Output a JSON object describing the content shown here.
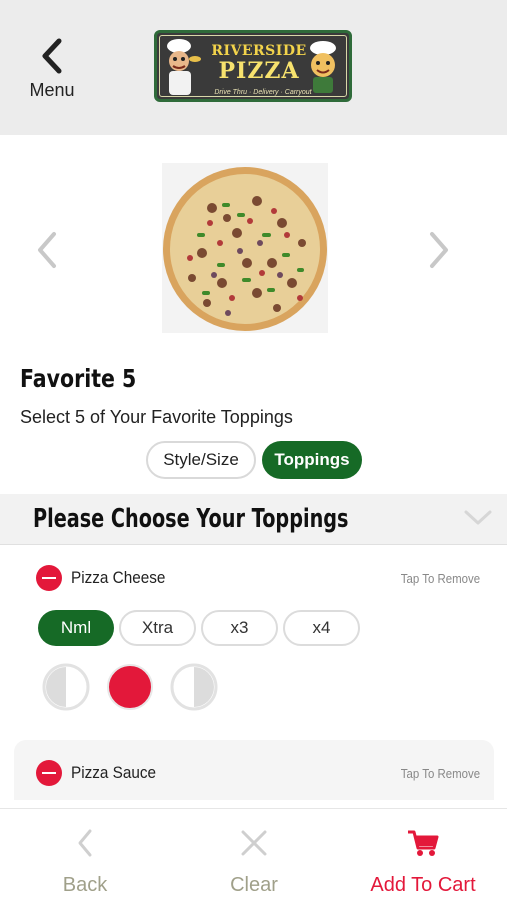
{
  "header": {
    "menu_label": "Menu",
    "logo": {
      "line1": "RIVERSIDE",
      "line2": "PIZZA",
      "tagline": "Drive Thru · Delivery · Carryout"
    }
  },
  "product": {
    "title": "Favorite 5",
    "subtitle": "Select 5 of Your Favorite Toppings",
    "tabs": [
      {
        "label": "Style/Size",
        "active": false
      },
      {
        "label": "Toppings",
        "active": true
      }
    ]
  },
  "section": {
    "title": "Please Choose Your Toppings"
  },
  "toppings": [
    {
      "name": "Pizza Cheese",
      "remove_label": "Tap To Remove",
      "amounts": [
        {
          "label": "Nml",
          "selected": true
        },
        {
          "label": "Xtra",
          "selected": false
        },
        {
          "label": "x3",
          "selected": false
        },
        {
          "label": "x4",
          "selected": false
        }
      ],
      "coverage_selected": "whole"
    },
    {
      "name": "Pizza Sauce",
      "remove_label": "Tap To Remove"
    }
  ],
  "bottom_bar": {
    "back_label": "Back",
    "clear_label": "Clear",
    "cart_label": "Add To Cart"
  },
  "colors": {
    "accent_green": "#166a26",
    "accent_red": "#e3183a",
    "muted_text": "#a0a08a"
  }
}
